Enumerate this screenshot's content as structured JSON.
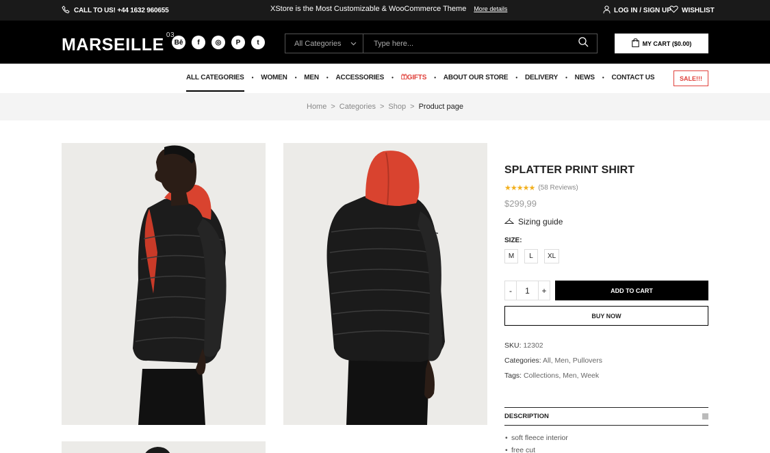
{
  "topbar": {
    "phone": "CALL TO US! +44 1632 960655",
    "promo": "XStore is the Most Customizable & WooCommerce Theme",
    "more": "More details",
    "login": "LOG IN / SIGN UP",
    "wishlist": "WISHLIST"
  },
  "header": {
    "logo": "MARSEILLE",
    "logo_sup": "03",
    "socials": [
      {
        "icon": "behance-icon",
        "glyph": "Bē"
      },
      {
        "icon": "facebook-icon",
        "glyph": "f"
      },
      {
        "icon": "instagram-icon",
        "glyph": "◎"
      },
      {
        "icon": "pinterest-icon",
        "glyph": "P"
      },
      {
        "icon": "twitter-icon",
        "glyph": "t"
      }
    ],
    "category": "All Categories",
    "search_placeholder": "Type here...",
    "cart": "MY CART ($0.00)"
  },
  "nav": {
    "items": [
      "ALL CATEGORIES",
      "WOMEN",
      "MEN",
      "ACCESSORIES",
      "GIFTS",
      "ABOUT OUR STORE",
      "DELIVERY",
      "NEWS",
      "CONTACT US"
    ],
    "sale": "SALE!!!"
  },
  "breadcrumb": {
    "home": "Home",
    "categories": "Categories",
    "shop": "Shop",
    "current": "Product page",
    "sep": ">"
  },
  "product": {
    "title": "SPLATTER PRINT SHIRT",
    "stars": "★★★★★",
    "rating_value": 5,
    "reviews": "(58 Reviews)",
    "price": "$299,99",
    "sizing": "Sizing guide",
    "size_label": "SIZE:",
    "sizes": [
      "M",
      "L",
      "XL"
    ],
    "qty_minus": "-",
    "qty": "1",
    "qty_plus": "+",
    "add_to_cart": "ADD TO CART",
    "buy_now": "BUY NOW",
    "sku_label": "SKU:",
    "sku": "12302",
    "categories_label": "Categories:",
    "categories": "All, Men, Pullovers",
    "tags_label": "Tags:",
    "tags": "Collections, Men, Week",
    "description_label": "DESCRIPTION",
    "bullets": [
      "soft fleece interior",
      "free cut"
    ]
  },
  "colors": {
    "accent_red": "#e0403a",
    "star": "#f2b01e",
    "hood": "#d9432f"
  }
}
